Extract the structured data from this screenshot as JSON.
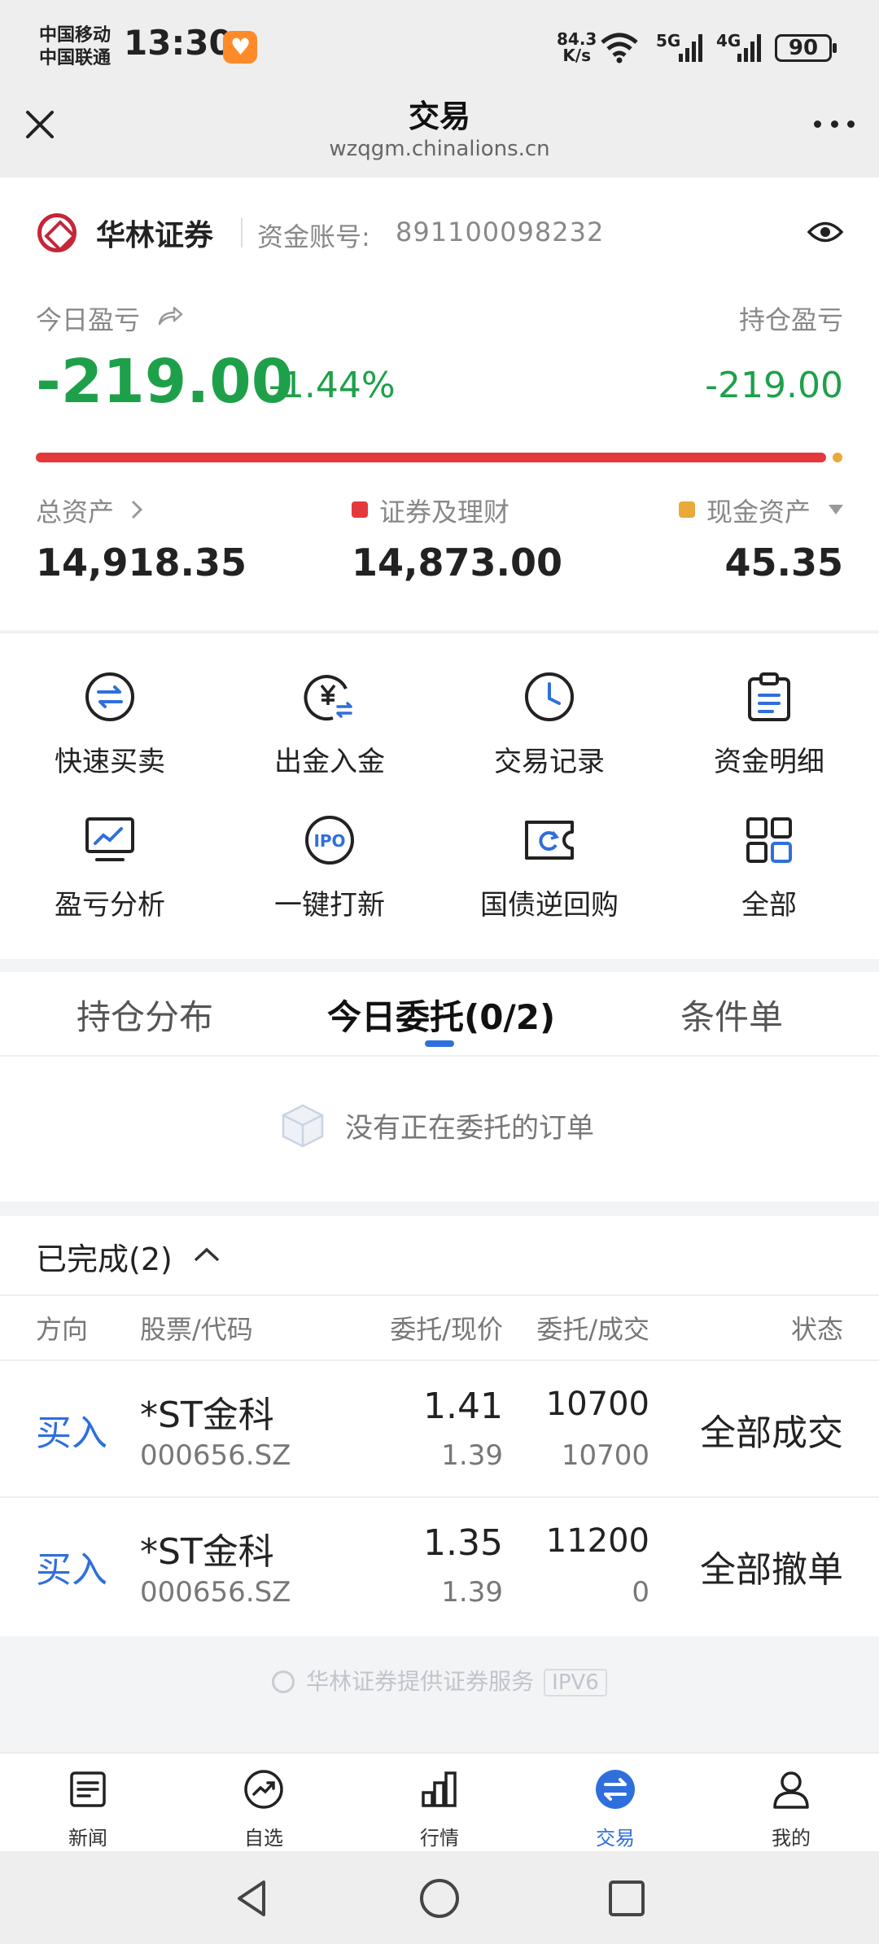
{
  "status": {
    "carrier1": "中国移动",
    "carrier2": "中国联通",
    "time": "13:30",
    "speed_value": "84.3",
    "speed_unit": "K/s",
    "net1": "5G",
    "net2": "4G",
    "battery": "90"
  },
  "header": {
    "title": "交易",
    "url": "wzqgm.chinalions.cn"
  },
  "account": {
    "broker": "华林证券",
    "account_label": "资金账号:",
    "account_no": "891100098232",
    "today_pnl_label": "今日盈亏",
    "today_pnl": "-219.00",
    "today_pnl_pct": "-1.44%",
    "hold_pnl_label": "持仓盈亏",
    "hold_pnl": "-219.00",
    "total_label": "总资产",
    "total_value": "14,918.35",
    "securities_label": "证券及理财",
    "securities_value": "14,873.00",
    "cash_label": "现金资产",
    "cash_value": "45.35",
    "allocation_fraction_securities": 0.997
  },
  "menu": [
    {
      "label": "快速买卖",
      "icon": "swap-circle-icon"
    },
    {
      "label": "出金入金",
      "icon": "yuan-transfer-icon"
    },
    {
      "label": "交易记录",
      "icon": "clock-icon"
    },
    {
      "label": "资金明细",
      "icon": "clipboard-icon"
    },
    {
      "label": "盈亏分析",
      "icon": "monitor-chart-icon"
    },
    {
      "label": "一键打新",
      "icon": "ipo-icon"
    },
    {
      "label": "国债逆回购",
      "icon": "ticket-refresh-icon"
    },
    {
      "label": "全部",
      "icon": "grid-icon"
    }
  ],
  "tabs": [
    {
      "label": "持仓分布"
    },
    {
      "label": "今日委托(0/2)"
    },
    {
      "label": "条件单"
    }
  ],
  "empty_text": "没有正在委托的订单",
  "completed": {
    "title": "已完成(2)",
    "columns": [
      "方向",
      "股票/代码",
      "委托/现价",
      "委托/成交",
      "状态"
    ],
    "rows": [
      {
        "direction": "买入",
        "name": "*ST金科",
        "code": "000656.SZ",
        "order_price": "1.41",
        "last_price": "1.39",
        "order_qty": "10700",
        "filled_qty": "10700",
        "status": "全部成交"
      },
      {
        "direction": "买入",
        "name": "*ST金科",
        "code": "000656.SZ",
        "order_price": "1.35",
        "last_price": "1.39",
        "order_qty": "11200",
        "filled_qty": "0",
        "status": "全部撤单"
      }
    ]
  },
  "footer": {
    "text": "华林证券提供证券服务",
    "ipv6": "IPV6"
  },
  "nav": [
    {
      "label": "新闻",
      "icon": "news-icon"
    },
    {
      "label": "自选",
      "icon": "trend-icon"
    },
    {
      "label": "行情",
      "icon": "bar-chart-icon"
    },
    {
      "label": "交易",
      "icon": "exchange-icon",
      "active": true
    },
    {
      "label": "我的",
      "icon": "user-icon"
    }
  ],
  "colors": {
    "down_green": "#1ea04a",
    "up_red": "#e4393c",
    "cash_orange": "#e9a93b",
    "accent_blue": "#2f6fdd"
  }
}
